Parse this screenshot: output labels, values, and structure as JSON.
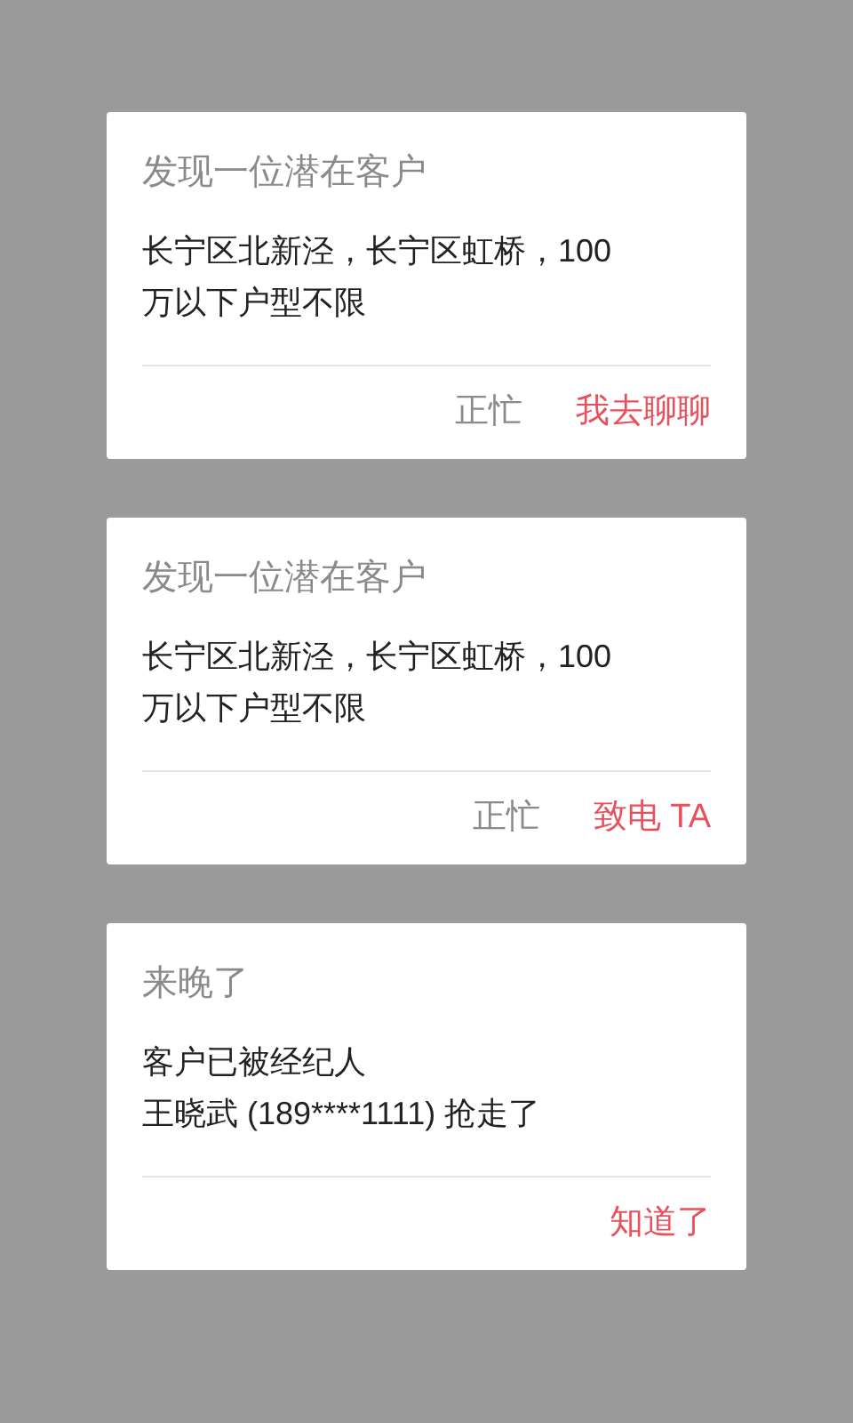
{
  "cards": [
    {
      "title": "发现一位潜在客户",
      "body": [
        "长宁区北新泾，长宁区虹桥，100",
        "万以下户型不限"
      ],
      "actions": [
        {
          "label": "正忙",
          "kind": "secondary"
        },
        {
          "label": "我去聊聊",
          "kind": "primary"
        }
      ]
    },
    {
      "title": "发现一位潜在客户",
      "body": [
        "长宁区北新泾，长宁区虹桥，100",
        "万以下户型不限"
      ],
      "actions": [
        {
          "label": "正忙",
          "kind": "secondary"
        },
        {
          "label": "致电 TA",
          "kind": "primary"
        }
      ]
    },
    {
      "title": "来晚了",
      "body": [
        "客户已被经纪人",
        "王晓武 (189****1111) 抢走了"
      ],
      "actions": [
        {
          "label": "知道了",
          "kind": "primary"
        }
      ]
    }
  ]
}
